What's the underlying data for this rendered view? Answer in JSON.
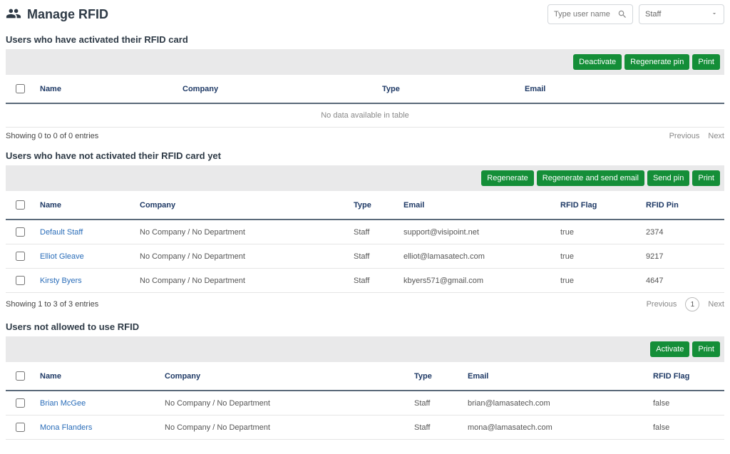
{
  "header": {
    "title": "Manage RFID",
    "search_placeholder": "Type user name",
    "filter_selected": "Staff"
  },
  "section1": {
    "title": "Users who have activated their RFID card",
    "buttons": {
      "deactivate": "Deactivate",
      "regen_pin": "Regenerate pin",
      "print": "Print"
    },
    "cols": {
      "name": "Name",
      "company": "Company",
      "type": "Type",
      "email": "Email"
    },
    "empty": "No data available in table",
    "entries_text": "Showing 0 to 0 of 0 entries",
    "prev": "Previous",
    "next": "Next"
  },
  "section2": {
    "title": "Users who have not activated their RFID card yet",
    "buttons": {
      "regen": "Regenerate",
      "regen_send": "Regenerate and send email",
      "send_pin": "Send pin",
      "print": "Print"
    },
    "cols": {
      "name": "Name",
      "company": "Company",
      "type": "Type",
      "email": "Email",
      "flag": "RFID Flag",
      "pin": "RFID Pin"
    },
    "rows": [
      {
        "name": "Default Staff",
        "company": "No Company / No Department",
        "type": "Staff",
        "email": "support@visipoint.net",
        "flag": "true",
        "pin": "2374"
      },
      {
        "name": "Elliot Gleave",
        "company": "No Company / No Department",
        "type": "Staff",
        "email": "elliot@lamasatech.com",
        "flag": "true",
        "pin": "9217"
      },
      {
        "name": "Kirsty Byers",
        "company": "No Company / No Department",
        "type": "Staff",
        "email": "kbyers571@gmail.com",
        "flag": "true",
        "pin": "4647"
      }
    ],
    "entries_text": "Showing 1 to 3 of 3 entries",
    "prev": "Previous",
    "page": "1",
    "next": "Next"
  },
  "section3": {
    "title": "Users not allowed to use RFID",
    "buttons": {
      "activate": "Activate",
      "print": "Print"
    },
    "cols": {
      "name": "Name",
      "company": "Company",
      "type": "Type",
      "email": "Email",
      "flag": "RFID Flag"
    },
    "rows": [
      {
        "name": "Brian McGee",
        "company": "No Company / No Department",
        "type": "Staff",
        "email": "brian@lamasatech.com",
        "flag": "false"
      },
      {
        "name": "Mona Flanders",
        "company": "No Company / No Department",
        "type": "Staff",
        "email": "mona@lamasatech.com",
        "flag": "false"
      }
    ]
  }
}
